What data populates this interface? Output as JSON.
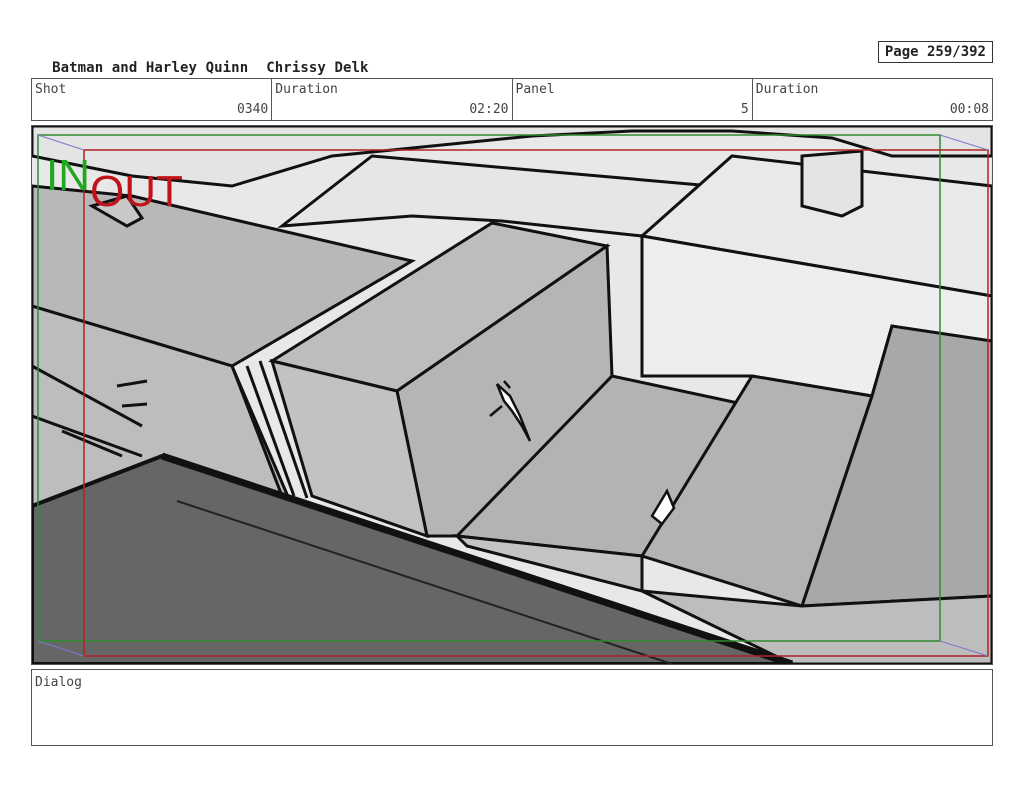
{
  "header": {
    "title": "Batman and Harley Quinn",
    "artist": "Chrissy Delk",
    "page": "Page 259/392"
  },
  "meta": [
    {
      "label": "Shot",
      "value": "0340"
    },
    {
      "label": "Duration",
      "value": "02:20"
    },
    {
      "label": "Panel",
      "value": "5"
    },
    {
      "label": "Duration",
      "value": "00:08"
    }
  ],
  "panel": {
    "in_marker": "IN",
    "out_marker": "OUT",
    "colors": {
      "in_frame": "#2e8b2e",
      "out_frame": "#b22222",
      "in_text": "#1fa81f",
      "out_text": "#c0141a"
    }
  },
  "dialog": {
    "label": "Dialog",
    "text": ""
  }
}
